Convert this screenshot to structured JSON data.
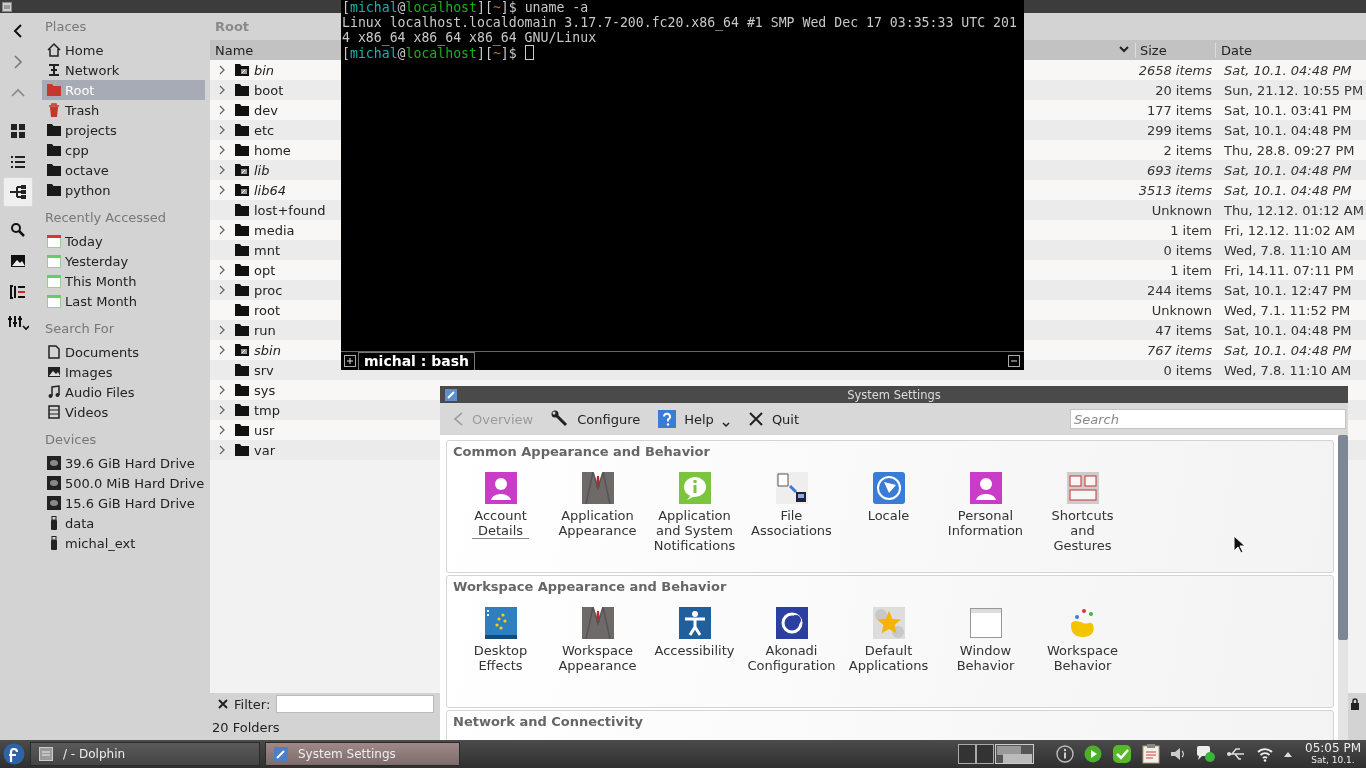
{
  "dolphin": {
    "view_modes": [
      {
        "selected": false
      },
      {
        "selected": false
      },
      {
        "selected": true
      }
    ],
    "places": [
      {
        "heading": "Places",
        "items": [
          {
            "label": "Home",
            "selected": false
          },
          {
            "label": "Network",
            "selected": false
          },
          {
            "label": "Root",
            "selected": true
          },
          {
            "label": "Trash",
            "selected": false
          },
          {
            "label": "projects",
            "selected": false
          },
          {
            "label": "cpp",
            "selected": false
          },
          {
            "label": "octave",
            "selected": false
          },
          {
            "label": "python",
            "selected": false
          }
        ]
      },
      {
        "heading": "Recently Accessed",
        "items": [
          {
            "label": "Today",
            "selected": false
          },
          {
            "label": "Yesterday",
            "selected": false
          },
          {
            "label": "This Month",
            "selected": false
          },
          {
            "label": "Last Month",
            "selected": false
          }
        ]
      },
      {
        "heading": "Search For",
        "items": [
          {
            "label": "Documents",
            "selected": false
          },
          {
            "label": "Images",
            "selected": false
          },
          {
            "label": "Audio Files",
            "selected": false
          },
          {
            "label": "Videos",
            "selected": false
          }
        ]
      },
      {
        "heading": "Devices",
        "items": [
          {
            "label": "39.6 GiB Hard Drive",
            "selected": false
          },
          {
            "label": "500.0 MiB Hard Drive",
            "selected": false
          },
          {
            "label": "15.6 GiB Hard Drive",
            "selected": false
          },
          {
            "label": "data",
            "selected": false
          },
          {
            "label": "michal_ext",
            "selected": false
          }
        ]
      }
    ],
    "breadcrumb": "Root",
    "columns": [
      "Name",
      "Size",
      "Date"
    ],
    "rows": [
      {
        "name": "bin",
        "link": true,
        "expandable": true,
        "size": "2658 items",
        "date": "Sat, 10.1. 04:48 PM"
      },
      {
        "name": "boot",
        "link": false,
        "expandable": true,
        "size": "20 items",
        "date": "Sun, 21.12. 10:55 PM"
      },
      {
        "name": "dev",
        "link": false,
        "expandable": true,
        "size": "177 items",
        "date": "Sat, 10.1. 03:41 PM"
      },
      {
        "name": "etc",
        "link": false,
        "expandable": true,
        "size": "299 items",
        "date": "Sat, 10.1. 04:48 PM"
      },
      {
        "name": "home",
        "link": false,
        "expandable": true,
        "size": "2 items",
        "date": "Thu, 28.8. 09:27 PM"
      },
      {
        "name": "lib",
        "link": true,
        "expandable": true,
        "size": "693 items",
        "date": "Sat, 10.1. 04:48 PM"
      },
      {
        "name": "lib64",
        "link": true,
        "expandable": true,
        "size": "3513 items",
        "date": "Sat, 10.1. 04:48 PM"
      },
      {
        "name": "lost+found",
        "link": false,
        "expandable": false,
        "size": "Unknown",
        "date": "Thu, 12.12. 01:12 AM"
      },
      {
        "name": "media",
        "link": false,
        "expandable": true,
        "size": "1 item",
        "date": "Fri, 12.12. 11:02 AM"
      },
      {
        "name": "mnt",
        "link": false,
        "expandable": false,
        "size": "0 items",
        "date": "Wed, 7.8. 11:10 AM"
      },
      {
        "name": "opt",
        "link": false,
        "expandable": true,
        "size": "1 item",
        "date": "Fri, 14.11. 07:11 PM"
      },
      {
        "name": "proc",
        "link": false,
        "expandable": true,
        "size": "244 items",
        "date": "Sat, 10.1. 12:47 PM"
      },
      {
        "name": "root",
        "link": false,
        "expandable": false,
        "size": "Unknown",
        "date": "Wed, 7.1. 11:52 PM"
      },
      {
        "name": "run",
        "link": false,
        "expandable": true,
        "size": "47 items",
        "date": "Sat, 10.1. 04:48 PM"
      },
      {
        "name": "sbin",
        "link": true,
        "expandable": true,
        "size": "767 items",
        "date": "Sat, 10.1. 04:48 PM"
      },
      {
        "name": "srv",
        "link": false,
        "expandable": false,
        "size": "0 items",
        "date": "Wed, 7.8. 11:10 AM"
      },
      {
        "name": "sys",
        "link": false,
        "expandable": true
      },
      {
        "name": "tmp",
        "link": false,
        "expandable": true
      },
      {
        "name": "usr",
        "link": false,
        "expandable": true
      },
      {
        "name": "var",
        "link": false,
        "expandable": true
      }
    ],
    "filter": {
      "label": "Filter:"
    },
    "status": "20 Folders"
  },
  "terminal": {
    "lines": [
      {
        "cursor": false,
        "segments": [
          {
            "text": "[",
            "color": "#c8c8c8"
          },
          {
            "text": "michal",
            "color": "#18b2b2"
          },
          {
            "text": "@",
            "color": "#c8c8c8"
          },
          {
            "text": "localhost",
            "color": "#18b218"
          },
          {
            "text": "][",
            "color": "#c8c8c8"
          },
          {
            "text": "~",
            "color": "#b26818"
          },
          {
            "text": "]$ uname -a",
            "color": "#c8c8c8"
          }
        ]
      },
      {
        "cursor": false,
        "segments": [
          {
            "text": "Linux localhost.localdomain 3.17.7-200.fc20.x86_64 #1 SMP Wed Dec 17 03:35:33 UTC 201",
            "color": "#c8c8c8"
          }
        ]
      },
      {
        "cursor": false,
        "segments": [
          {
            "text": "4 x86_64 x86_64 x86_64 GNU/Linux",
            "color": "#c8c8c8"
          }
        ]
      },
      {
        "cursor": true,
        "segments": [
          {
            "text": "[",
            "color": "#c8c8c8"
          },
          {
            "text": "michal",
            "color": "#18b2b2"
          },
          {
            "text": "@",
            "color": "#c8c8c8"
          },
          {
            "text": "localhost",
            "color": "#18b218"
          },
          {
            "text": "][",
            "color": "#c8c8c8"
          },
          {
            "text": "~",
            "color": "#b26818"
          },
          {
            "text": "]$ ",
            "color": "#c8c8c8"
          }
        ]
      }
    ],
    "tab": "michal : bash"
  },
  "settings": {
    "title": "System Settings",
    "toolbar": [
      {
        "label": "Overview",
        "disabled": true
      },
      {
        "label": "Configure",
        "disabled": false
      },
      {
        "label": "Help",
        "disabled": false
      },
      {
        "label": "Quit",
        "disabled": false
      }
    ],
    "search": {
      "placeholder": "Search"
    },
    "groups": [
      {
        "title": "Common Appearance and Behavior",
        "items": [
          {
            "label": "Account\nDetails",
            "focused": true
          },
          {
            "label": "Application\nAppearance",
            "focused": false
          },
          {
            "label": "Application\nand System\nNotifications",
            "focused": false
          },
          {
            "label": "File\nAssociations",
            "focused": false
          },
          {
            "label": "Locale",
            "focused": false
          },
          {
            "label": "Personal\nInformation",
            "focused": false
          },
          {
            "label": "Shortcuts\nand\nGestures",
            "focused": false
          }
        ]
      },
      {
        "title": "Workspace Appearance and Behavior",
        "items": [
          {
            "label": "Desktop\nEffects",
            "focused": false
          },
          {
            "label": "Workspace\nAppearance",
            "focused": false
          },
          {
            "label": "Accessibility",
            "focused": false
          },
          {
            "label": "Akonadi\nConfiguration",
            "focused": false
          },
          {
            "label": "Default\nApplications",
            "focused": false
          },
          {
            "label": "Window\nBehavior",
            "focused": false
          },
          {
            "label": "Workspace\nBehavior",
            "focused": false
          }
        ]
      },
      {
        "title": "Network and Connectivity"
      }
    ]
  },
  "taskbar": {
    "tasks": [
      {
        "label": "/ - Dolphin",
        "selected": false
      },
      {
        "label": "System Settings",
        "selected": true
      }
    ],
    "clock": {
      "time": "05:05 PM",
      "date": "Sat, 10.1."
    }
  }
}
